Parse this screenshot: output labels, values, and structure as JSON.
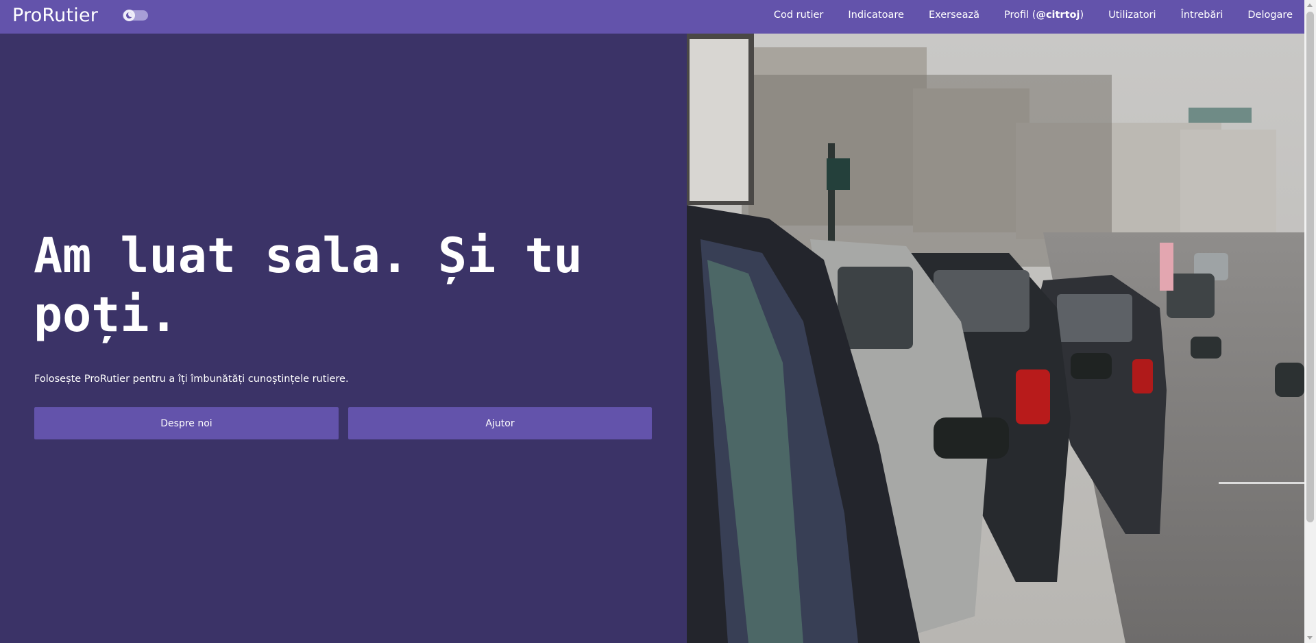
{
  "header": {
    "brand": "ProRutier",
    "theme_toggle_icon": "moon-icon",
    "nav": [
      {
        "label": "Cod rutier"
      },
      {
        "label": "Indicatoare"
      },
      {
        "label": "Exersează"
      },
      {
        "label_prefix": "Profil (",
        "handle": "@citrtoj",
        "label_suffix": ")"
      },
      {
        "label": "Utilizatori"
      },
      {
        "label": "Întrebări"
      },
      {
        "label": "Delogare"
      }
    ]
  },
  "hero": {
    "headline": "Am luat sala. Și tu poți.",
    "subtitle": "Folosește ProRutier pentru a îți îmbunătăți cunoștințele rutiere.",
    "buttons": {
      "about": "Despre noi",
      "help": "Ajutor"
    }
  },
  "colors": {
    "navbar": "#6353ab",
    "hero_background": "#3b3367",
    "button": "#6353ab",
    "text": "#ffffff"
  }
}
